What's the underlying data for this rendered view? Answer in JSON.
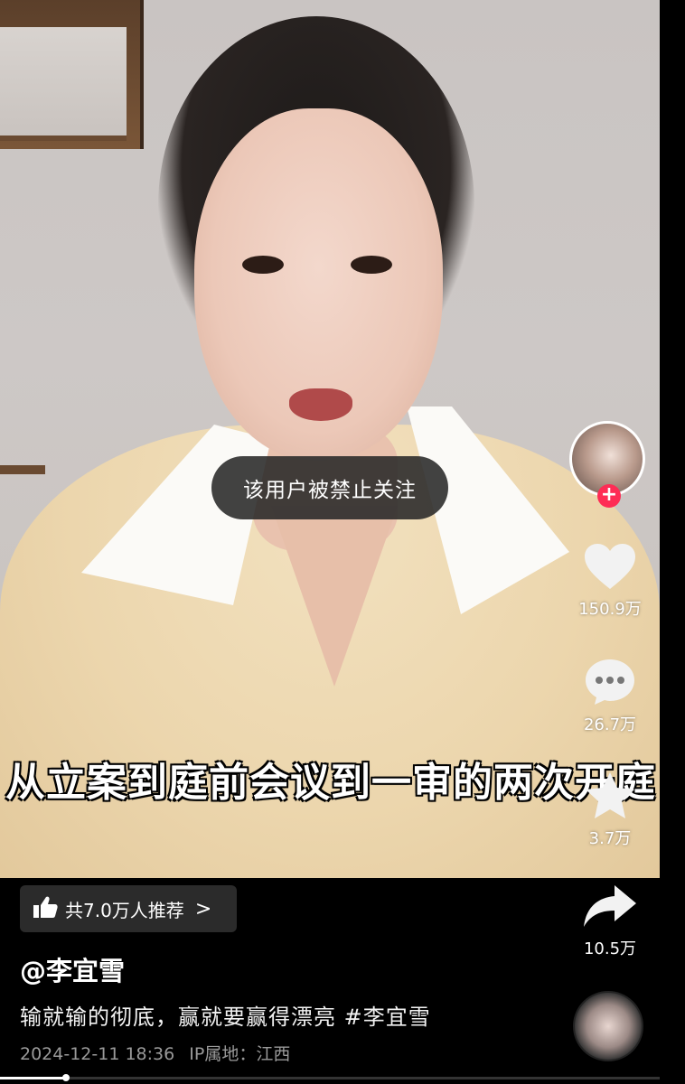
{
  "toast": {
    "text": "该用户被禁止关注"
  },
  "subtitle": {
    "text": "从立案到庭前会议到一审的两次开庭"
  },
  "actions": {
    "likes": "150.9万",
    "comments": "26.7万",
    "favorites": "3.7万",
    "shares": "10.5万"
  },
  "recommend": {
    "label": "共7.0万人推荐",
    "chevron": ">"
  },
  "author": {
    "name": "@李宜雪"
  },
  "description": {
    "text": "输就输的彻底，赢就要赢得漂亮 #李宜雪"
  },
  "meta": {
    "timestamp": "2024-12-11 18:36",
    "ip_location": "IP属地：江西"
  },
  "icons": {
    "follow": "plus-icon",
    "like": "heart-icon",
    "comment": "comment-bubble-icon",
    "favorite": "star-icon",
    "share": "share-arrow-icon",
    "recommend": "thumbs-up-icon",
    "chevron": "chevron-right-icon"
  },
  "colors": {
    "accent": "#fe2c55",
    "background": "#000000",
    "toast": "#282828"
  },
  "progress": {
    "fraction": 0.1
  }
}
